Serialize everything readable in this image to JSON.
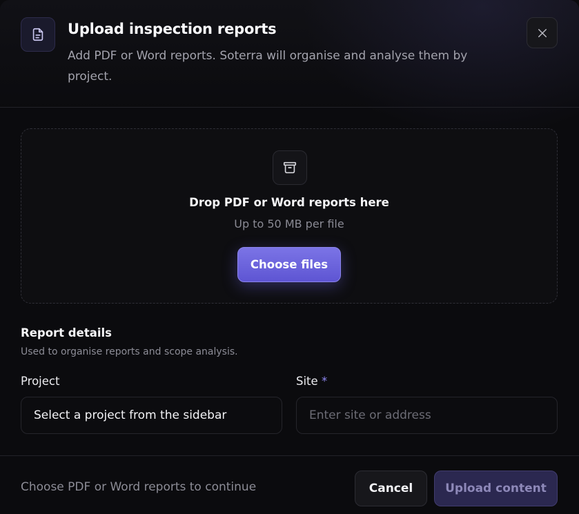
{
  "header": {
    "title": "Upload inspection reports",
    "subtitle": "Add PDF or Word reports. Soterra will organise and analyse them by project.",
    "icon": "document-icon",
    "close_icon": "close-icon"
  },
  "dropzone": {
    "icon": "archive-icon",
    "title": "Drop PDF or Word reports here",
    "subtitle": "Up to 50 MB per file",
    "button_label": "Choose files"
  },
  "details": {
    "title": "Report details",
    "subtitle": "Used to organise reports and scope analysis.",
    "project": {
      "label": "Project",
      "value": "Select a project from the sidebar"
    },
    "site": {
      "label": "Site",
      "required_mark": "*",
      "value": "",
      "placeholder": "Enter site or address"
    }
  },
  "footer": {
    "hint": "Choose PDF or Word reports to continue",
    "cancel_label": "Cancel",
    "upload_label": "Upload content"
  },
  "colors": {
    "accent": "#6d65e0",
    "background": "#0b0b0e",
    "disabled_button": "#2b2850"
  }
}
